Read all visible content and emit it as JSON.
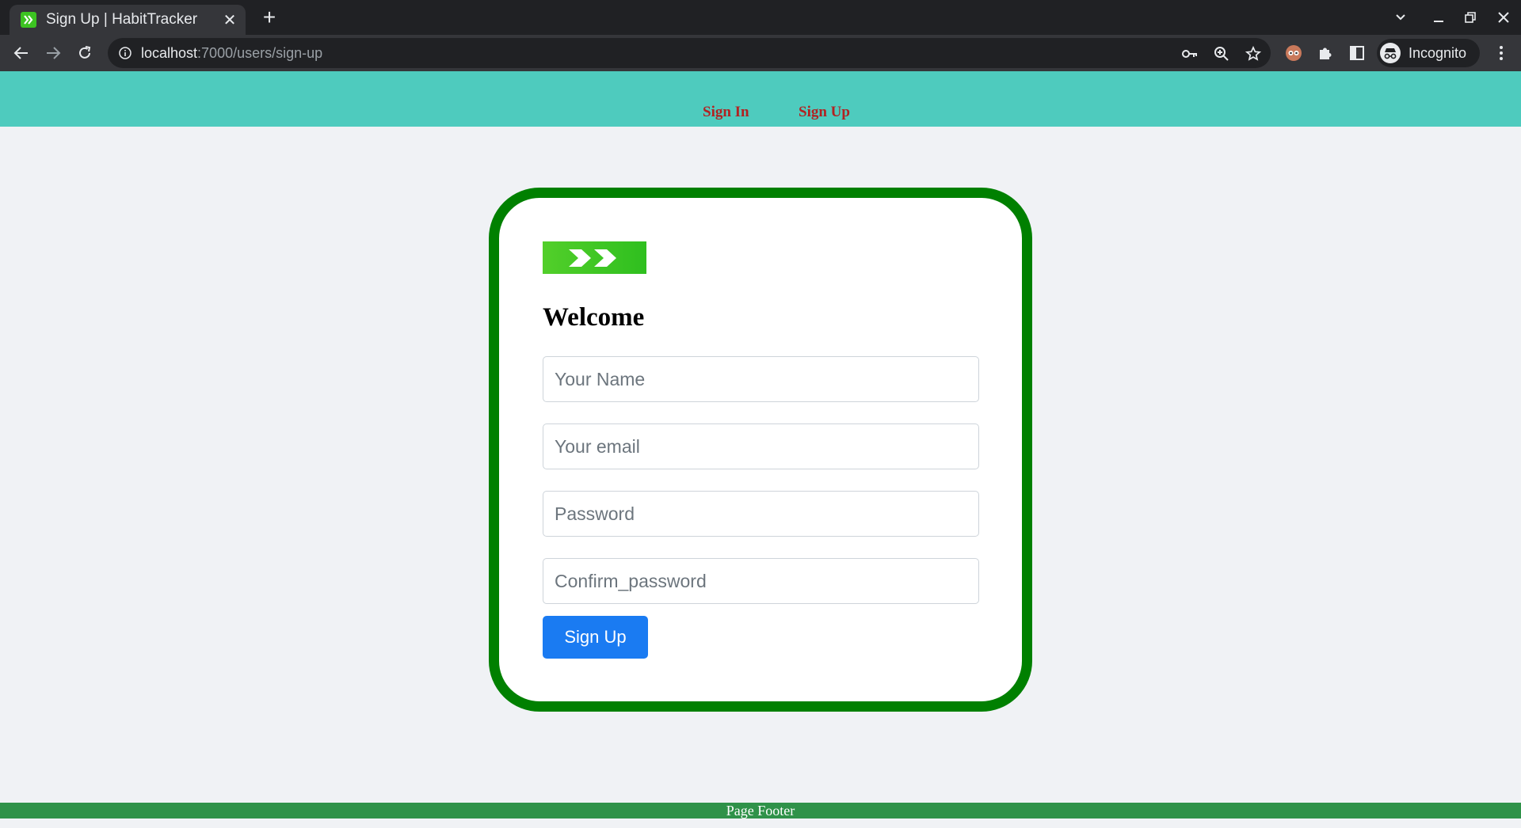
{
  "browser": {
    "tab_title": "Sign Up | HabitTracker",
    "tab_close": "✕",
    "new_tab": "+",
    "url_host": "localhost",
    "url_rest": ":7000/users/sign-up",
    "profile_label": "Incognito"
  },
  "header": {
    "nav": [
      {
        "label": "Sign In"
      },
      {
        "label": "Sign Up"
      }
    ]
  },
  "form": {
    "heading": "Welcome",
    "name_placeholder": "Your Name",
    "email_placeholder": "Your email",
    "password_placeholder": "Password",
    "confirm_placeholder": "Confirm_password",
    "submit_label": "Sign Up"
  },
  "footer": {
    "text": "Page Footer"
  },
  "colors": {
    "header_bg": "#4ecbbe",
    "card_border": "#008000",
    "button": "#1a7bf2",
    "nav_link": "#b22222",
    "footer_bg": "#2f9249"
  }
}
